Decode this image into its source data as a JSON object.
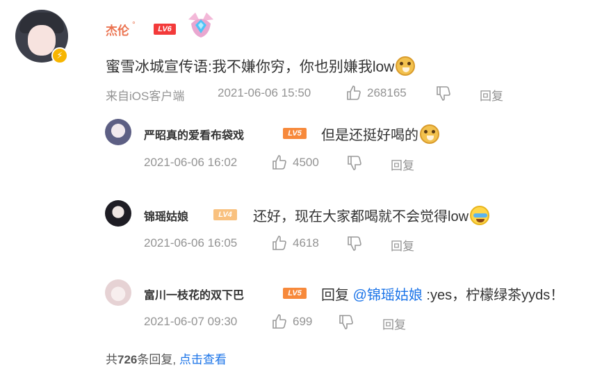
{
  "main_comment": {
    "username": "杰伦",
    "level": "LV6",
    "text": "蜜雪冰城宣传语:我不嫌你穷，你也别嫌我low",
    "emoji": "doge-emoji",
    "source": "来自iOS客户端",
    "timestamp": "2021-06-06 15:50",
    "likes": "268165",
    "reply_label": "回复"
  },
  "replies": [
    {
      "username": "严昭真的爱看布袋戏",
      "level": "LV5",
      "level_color": "#f7893b",
      "text": "但是还挺好喝的",
      "emoji": "doge-rose-emoji",
      "timestamp": "2021-06-06 16:02",
      "likes": "4500",
      "reply_label": "回复"
    },
    {
      "username": "锦瑶姑娘",
      "level": "LV4",
      "level_color": "#f9c17f",
      "text": "还好，现在大家都喝就不会觉得low",
      "emoji": "crying-emoji",
      "timestamp": "2021-06-06 16:05",
      "likes": "4618",
      "reply_label": "回复"
    },
    {
      "username": "富川一枝花的双下巴",
      "level": "LV5",
      "level_color": "#f7893b",
      "text_prefix": "回复 ",
      "mention": "@锦瑶姑娘",
      "text": " :yes，柠檬绿茶yyds！",
      "timestamp": "2021-06-07 09:30",
      "likes": "699",
      "reply_label": "回复"
    }
  ],
  "footer": {
    "prefix": "共",
    "count": "726",
    "suffix": "条回复,",
    "link": "点击查看"
  },
  "colors": {
    "username_main": "#eb7350",
    "link_blue": "#1a73e8",
    "meta_gray": "#939393",
    "level_red": "#f33a3a"
  }
}
